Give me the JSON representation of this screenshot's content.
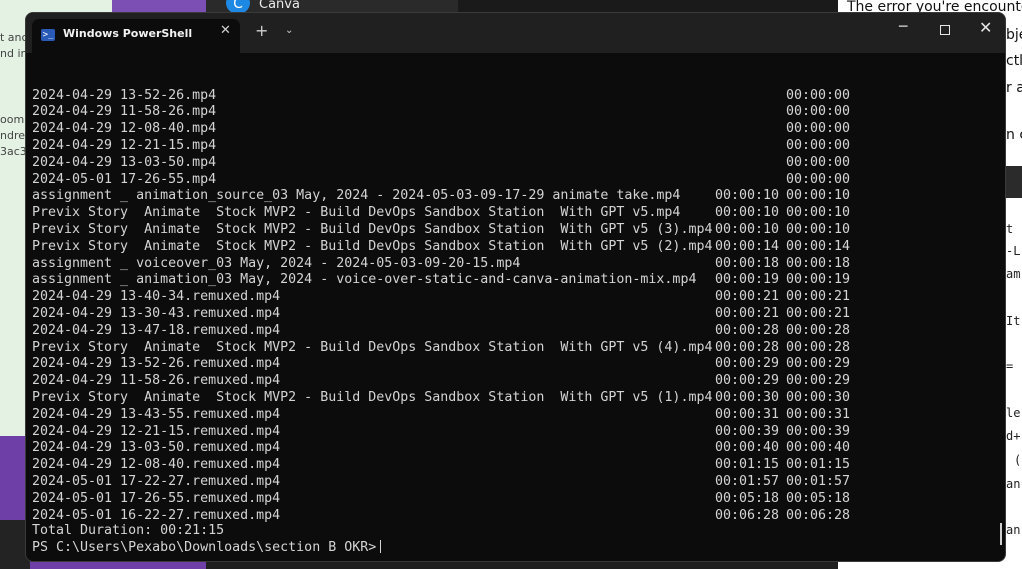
{
  "background": {
    "left_texts": [
      "t anc",
      "nd im",
      "oom",
      "ndres",
      "3ac3c"
    ],
    "canva_label": "Canva",
    "right_texts": [
      "The error you're encounte",
      "bje",
      "ctl",
      "r a",
      "n c"
    ],
    "right_code": [
      "t",
      "-L",
      "am",
      "It",
      "=",
      "le",
      "d+",
      "(",
      "an",
      "an"
    ]
  },
  "window": {
    "tab_title": "Windows PowerShell",
    "new_tab_symbol": "+",
    "dropdown_symbol": "⌄",
    "minimize_symbol": "─",
    "close_symbol": "✕"
  },
  "terminal": {
    "rows": [
      {
        "name": "2024-04-29 13-52-26.mp4",
        "d1": "",
        "d2": "00:00:00"
      },
      {
        "name": "2024-04-29 11-58-26.mp4",
        "d1": "",
        "d2": "00:00:00"
      },
      {
        "name": "2024-04-29 12-08-40.mp4",
        "d1": "",
        "d2": "00:00:00"
      },
      {
        "name": "2024-04-29 12-21-15.mp4",
        "d1": "",
        "d2": "00:00:00"
      },
      {
        "name": "2024-04-29 13-03-50.mp4",
        "d1": "",
        "d2": "00:00:00"
      },
      {
        "name": "2024-05-01 17-26-55.mp4",
        "d1": "",
        "d2": "00:00:00"
      },
      {
        "name": "assignment _ animation_source_03 May, 2024 - 2024-05-03-09-17-29 animate take.mp4",
        "d1": "00:00:10",
        "d2": "00:00:10"
      },
      {
        "name": "Previx Story  Animate  Stock MVP2 - Build DevOps Sandbox Station  With GPT v5.mp4",
        "d1": "00:00:10",
        "d2": "00:00:10"
      },
      {
        "name": "Previx Story  Animate  Stock MVP2 - Build DevOps Sandbox Station  With GPT v5 (3).mp4",
        "d1": "00:00:10",
        "d2": "00:00:10"
      },
      {
        "name": "Previx Story  Animate  Stock MVP2 - Build DevOps Sandbox Station  With GPT v5 (2).mp4",
        "d1": "00:00:14",
        "d2": "00:00:14"
      },
      {
        "name": "assignment _ voiceover_03 May, 2024 - 2024-05-03-09-20-15.mp4",
        "d1": "00:00:18",
        "d2": "00:00:18"
      },
      {
        "name": "assignment _ animation_03 May, 2024 - voice-over-static-and-canva-animation-mix.mp4",
        "d1": "00:00:19",
        "d2": "00:00:19"
      },
      {
        "name": "2024-04-29 13-40-34.remuxed.mp4",
        "d1": "00:00:21",
        "d2": "00:00:21"
      },
      {
        "name": "2024-04-29 13-30-43.remuxed.mp4",
        "d1": "00:00:21",
        "d2": "00:00:21"
      },
      {
        "name": "2024-04-29 13-47-18.remuxed.mp4",
        "d1": "00:00:28",
        "d2": "00:00:28"
      },
      {
        "name": "Previx Story  Animate  Stock MVP2 - Build DevOps Sandbox Station  With GPT v5 (4).mp4",
        "d1": "00:00:28",
        "d2": "00:00:28"
      },
      {
        "name": "2024-04-29 13-52-26.remuxed.mp4",
        "d1": "00:00:29",
        "d2": "00:00:29"
      },
      {
        "name": "2024-04-29 11-58-26.remuxed.mp4",
        "d1": "00:00:29",
        "d2": "00:00:29"
      },
      {
        "name": "Previx Story  Animate  Stock MVP2 - Build DevOps Sandbox Station  With GPT v5 (1).mp4",
        "d1": "00:00:30",
        "d2": "00:00:30"
      },
      {
        "name": "2024-04-29 13-43-55.remuxed.mp4",
        "d1": "00:00:31",
        "d2": "00:00:31"
      },
      {
        "name": "2024-04-29 12-21-15.remuxed.mp4",
        "d1": "00:00:39",
        "d2": "00:00:39"
      },
      {
        "name": "2024-04-29 13-03-50.remuxed.mp4",
        "d1": "00:00:40",
        "d2": "00:00:40"
      },
      {
        "name": "2024-04-29 12-08-40.remuxed.mp4",
        "d1": "00:01:15",
        "d2": "00:01:15"
      },
      {
        "name": "2024-05-01 17-22-27.remuxed.mp4",
        "d1": "00:01:57",
        "d2": "00:01:57"
      },
      {
        "name": "2024-05-01 17-26-55.remuxed.mp4",
        "d1": "00:05:18",
        "d2": "00:05:18"
      },
      {
        "name": "2024-05-01 16-22-27.remuxed.mp4",
        "d1": "00:06:28",
        "d2": "00:06:28"
      }
    ],
    "total_duration": "Total Duration: 00:21:15",
    "prompt": "PS C:\\Users\\Pexabo\\Downloads\\section B OKR>"
  }
}
